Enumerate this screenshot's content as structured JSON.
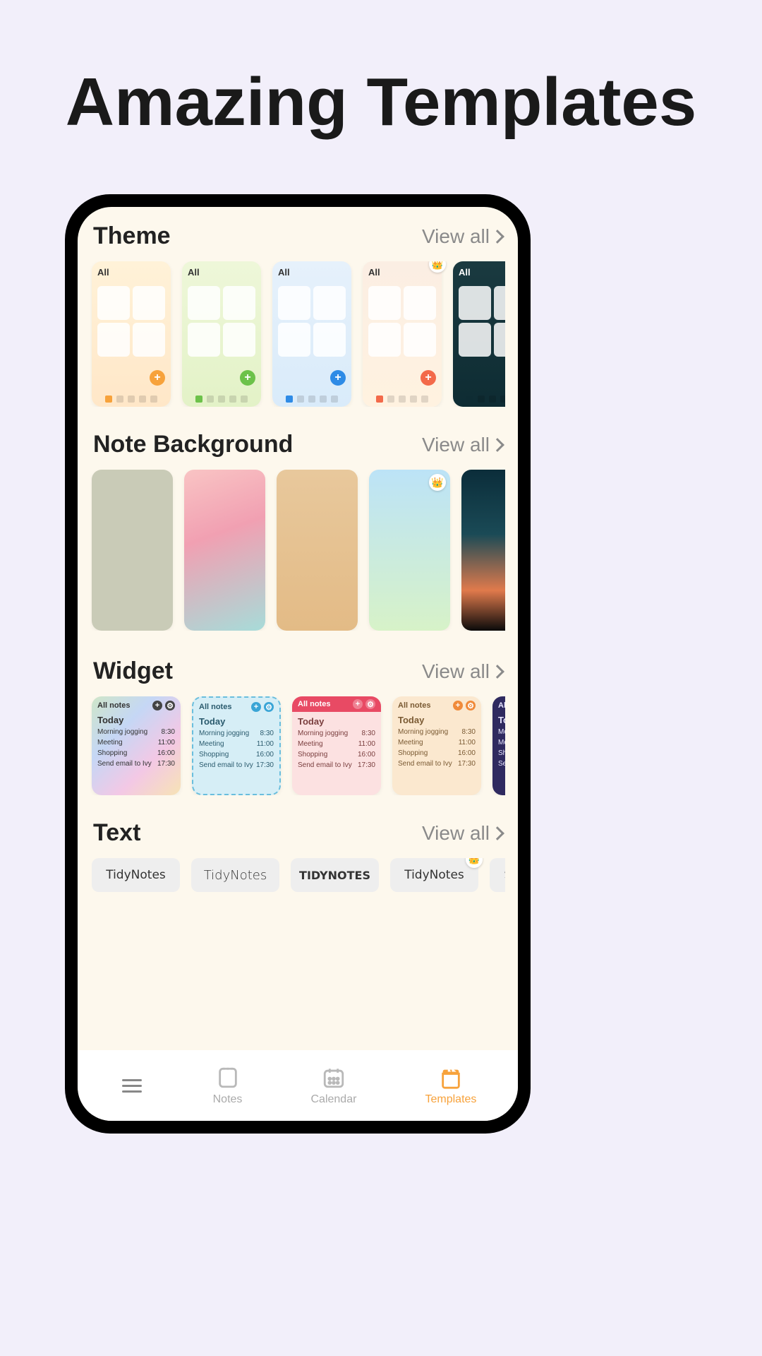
{
  "page_title": "Amazing Templates",
  "sections": {
    "theme": {
      "title": "Theme",
      "view_all": "View all"
    },
    "note_bg": {
      "title": "Note Background",
      "view_all": "View all"
    },
    "widget": {
      "title": "Widget",
      "view_all": "View all"
    },
    "text": {
      "title": "Text",
      "view_all": "View all"
    }
  },
  "themes": [
    {
      "label": "All",
      "bg": "linear-gradient(#fff2d8,#ffe7c8)",
      "fab": "#f7a23b",
      "premium": false,
      "dark": false
    },
    {
      "label": "All",
      "bg": "linear-gradient(#eef7d9,#e3f2c7)",
      "fab": "#6cc24a",
      "premium": false,
      "dark": false
    },
    {
      "label": "All",
      "bg": "linear-gradient(#e6f1fb,#d9ebfa)",
      "fab": "#2e8be6",
      "premium": false,
      "dark": false
    },
    {
      "label": "All",
      "bg": "linear-gradient(#fbeee3,#fff2e0)",
      "fab": "#f36a4a",
      "premium": true,
      "dark": false
    },
    {
      "label": "All",
      "bg": "linear-gradient(#1a3a40,#0e2c33)",
      "fab": "#0e2c33",
      "premium": false,
      "dark": true
    }
  ],
  "note_backgrounds": [
    {
      "bg": "linear-gradient(#c9cbb7,#c9cbb7)",
      "premium": false
    },
    {
      "bg": "linear-gradient(160deg,#f9c4c4 0%,#f1a0b2 40%,#a7dcd9 100%)",
      "premium": false
    },
    {
      "bg": "linear-gradient(#e8c89c,#e3bb86)",
      "premium": false
    },
    {
      "bg": "linear-gradient(#bce3f7,#d7f2c8)",
      "premium": true
    },
    {
      "bg": "linear-gradient(#0b2d3a 0%,#1a4a56 40%,#e07a4c 75%,#0a0a0a 100%)",
      "premium": false
    }
  ],
  "widget_common": {
    "tab_label": "All notes",
    "today_label": "Today",
    "items": [
      {
        "name": "Morning jogging",
        "time": "8:30"
      },
      {
        "name": "Meeting",
        "time": "11:00"
      },
      {
        "name": "Shopping",
        "time": "16:00"
      },
      {
        "name": "Send email to Ivy",
        "time": "17:30"
      }
    ]
  },
  "widgets": [
    {
      "bg": "linear-gradient(135deg,#cfe6c8,#c5d7f5,#f3c8e5,#f7e3b5)",
      "ic": "#444",
      "text": "#333"
    },
    {
      "bg": "#d6eef6",
      "ic": "#3aa5d6",
      "text": "#2b5b6e",
      "dashed": true
    },
    {
      "bg": "#fce1e1",
      "header_bg": "#e84a64",
      "ic": "#ffffff",
      "text": "#7a3e3e"
    },
    {
      "bg": "#fbe8cf",
      "ic": "#f08a3a",
      "text": "#7a5a33"
    },
    {
      "bg": "#2f2a5f",
      "ic": "#6a5ef0",
      "text": "#e8e6ff",
      "dark": true
    }
  ],
  "text_styles": [
    {
      "label": "TidyNotes",
      "font": "normal 400 17px system-ui",
      "premium": false
    },
    {
      "label": "TidyNotes",
      "font": "normal 300 18px 'Segoe UI', system-ui",
      "premium": false
    },
    {
      "label": "TIDYNOTES",
      "font": "normal 900 16px 'Arial Black', system-ui",
      "premium": false
    },
    {
      "label": "TidyNotes",
      "font": "normal 400 17px system-ui",
      "premium": true
    },
    {
      "label": "TIDYNOTES",
      "font": "italic 700 15px Georgia, serif",
      "premium": false
    }
  ],
  "nav": {
    "notes": "Notes",
    "calendar": "Calendar",
    "templates": "Templates"
  }
}
